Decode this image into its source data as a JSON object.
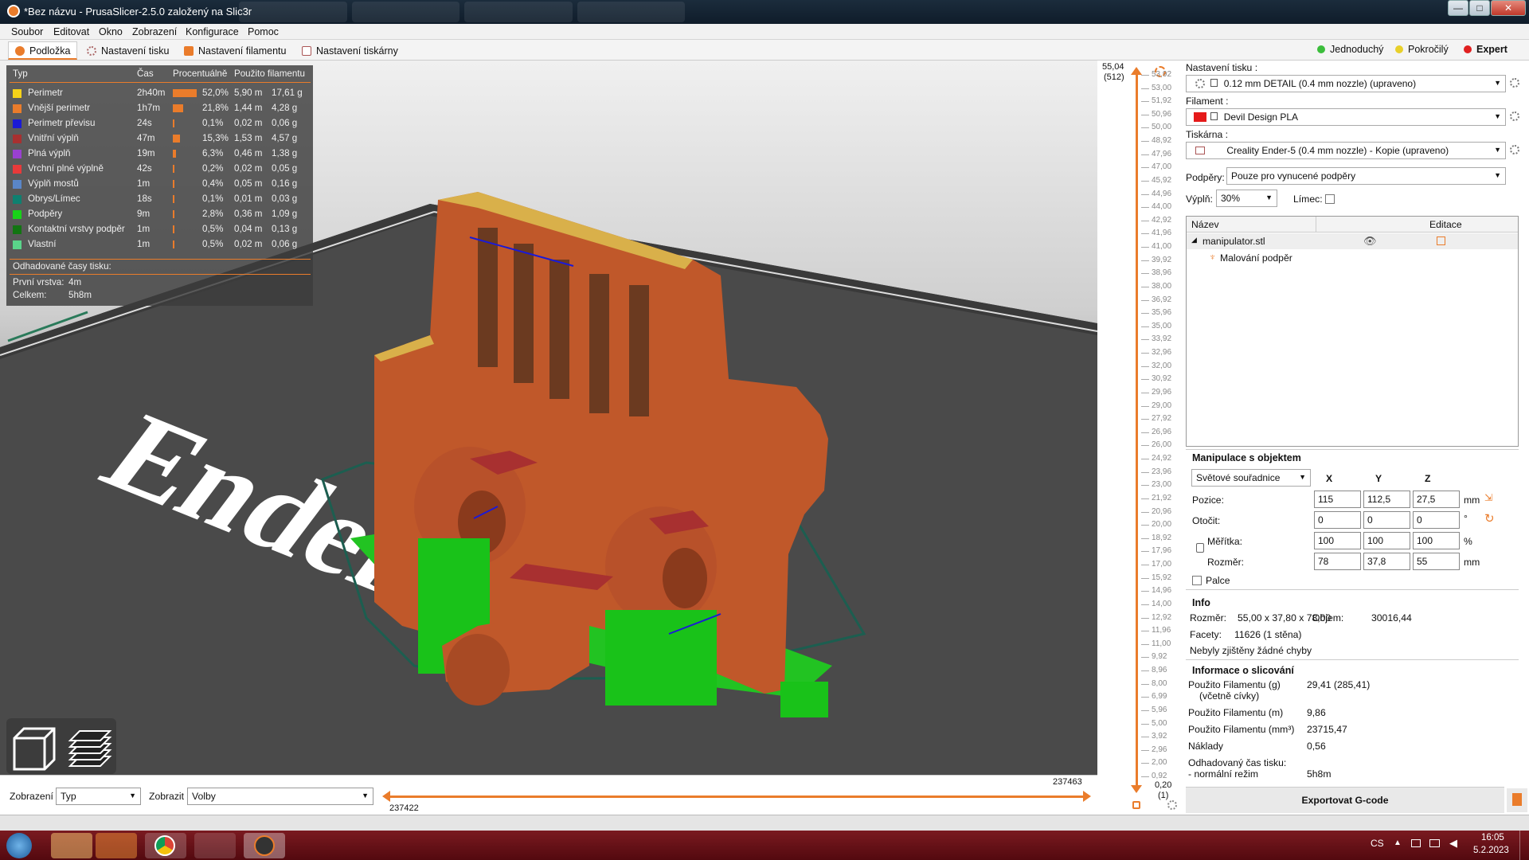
{
  "window": {
    "title": "*Bez názvu - PrusaSlicer-2.5.0 založený na Slic3r",
    "minimize": "—",
    "maximize": "□",
    "close": "✕"
  },
  "menu": [
    "Soubor",
    "Editovat",
    "Okno",
    "Zobrazení",
    "Konfigurace",
    "Pomoc"
  ],
  "tabs": [
    {
      "label": "Podložka",
      "active": true
    },
    {
      "label": "Nastavení tisku",
      "active": false
    },
    {
      "label": "Nastavení filamentu",
      "active": false
    },
    {
      "label": "Nastavení tiskárny",
      "active": false
    }
  ],
  "modes": [
    {
      "label": "Jednoduchý",
      "color": "#3bbd3b"
    },
    {
      "label": "Pokročilý",
      "color": "#e8d02a"
    },
    {
      "label": "Expert",
      "color": "#e02020"
    }
  ],
  "legend": {
    "headers": {
      "type": "Typ",
      "time": "Čas",
      "percent": "Procentuálně",
      "used": "Použito filamentu"
    },
    "rows": [
      {
        "type": "Perimetr",
        "color": "#f5d21a",
        "time": "2h40m",
        "pct": "52,0%",
        "pct_value": 52.0,
        "m": "5,90 m",
        "g": "17,61 g"
      },
      {
        "type": "Vnější perimetr",
        "color": "#ea7c2b",
        "time": "1h7m",
        "pct": "21,8%",
        "pct_value": 21.8,
        "m": "1,44 m",
        "g": "4,28 g"
      },
      {
        "type": "Perimetr převisu",
        "color": "#1a1ad6",
        "time": "24s",
        "pct": "0,1%",
        "pct_value": 0.1,
        "m": "0,02 m",
        "g": "0,06 g"
      },
      {
        "type": "Vnitřní výplň",
        "color": "#a83030",
        "time": "47m",
        "pct": "15,3%",
        "pct_value": 15.3,
        "m": "1,53 m",
        "g": "4,57 g"
      },
      {
        "type": "Plná výplň",
        "color": "#9a40d0",
        "time": "19m",
        "pct": "6,3%",
        "pct_value": 6.3,
        "m": "0,46 m",
        "g": "1,38 g"
      },
      {
        "type": "Vrchní plné výplně",
        "color": "#e83a3a",
        "time": "42s",
        "pct": "0,2%",
        "pct_value": 0.2,
        "m": "0,02 m",
        "g": "0,05 g"
      },
      {
        "type": "Výplň mostů",
        "color": "#5a86c8",
        "time": "1m",
        "pct": "0,4%",
        "pct_value": 0.4,
        "m": "0,05 m",
        "g": "0,16 g"
      },
      {
        "type": "Obrys/Límec",
        "color": "#0e8070",
        "time": "18s",
        "pct": "0,1%",
        "pct_value": 0.1,
        "m": "0,01 m",
        "g": "0,03 g"
      },
      {
        "type": "Podpěry",
        "color": "#19d219",
        "time": "9m",
        "pct": "2,8%",
        "pct_value": 2.8,
        "m": "0,36 m",
        "g": "1,09 g"
      },
      {
        "type": "Kontaktní vrstvy podpěr",
        "color": "#127512",
        "time": "1m",
        "pct": "0,5%",
        "pct_value": 0.5,
        "m": "0,04 m",
        "g": "0,13 g"
      },
      {
        "type": "Vlastní",
        "color": "#5ad48a",
        "time": "1m",
        "pct": "0,5%",
        "pct_value": 0.5,
        "m": "0,02 m",
        "g": "0,06 g"
      }
    ],
    "estimated_title": "Odhadované časy tisku:",
    "first_layer_label": "První vrstva:",
    "first_layer": "4m",
    "total_label": "Celkem:",
    "total": "5h8m"
  },
  "bottom": {
    "view_label": "Zobrazení",
    "view_value": "Typ",
    "show_label": "Zobrazit",
    "show_value": "Volby",
    "slider_low": "237422",
    "slider_high": "237463"
  },
  "vslider": {
    "top_value": "55,04",
    "top_layer": "(512)",
    "bottom_value": "0,20",
    "bottom_layer": "(1)",
    "ticks": [
      "53,92",
      "53,00",
      "51,92",
      "50,96",
      "50,00",
      "48,92",
      "47,96",
      "47,00",
      "45,92",
      "44,96",
      "44,00",
      "42,92",
      "41,96",
      "41,00",
      "39,92",
      "38,96",
      "38,00",
      "36,92",
      "35,96",
      "35,00",
      "33,92",
      "32,96",
      "32,00",
      "30,92",
      "29,96",
      "29,00",
      "27,92",
      "26,96",
      "26,00",
      "24,92",
      "23,96",
      "23,00",
      "21,92",
      "20,96",
      "20,00",
      "18,92",
      "17,96",
      "17,00",
      "15,92",
      "14,96",
      "14,00",
      "12,92",
      "11,96",
      "11,00",
      "9,92",
      "8,96",
      "8,00",
      "6,99",
      "5,96",
      "5,00",
      "3,92",
      "2,96",
      "2,00",
      "0,92"
    ]
  },
  "right": {
    "print_settings_label": "Nastavení tisku :",
    "print_settings_value": "0.12 mm DETAIL (0.4 mm nozzle) (upraveno)",
    "filament_label": "Filament :",
    "filament_value": "Devil Design PLA",
    "printer_label": "Tiskárna :",
    "printer_value": "Creality Ender-5 (0.4 mm nozzle) - Kopie (upraveno)",
    "supports_label": "Podpěry:",
    "supports_value": "Pouze pro vynucené podpěry",
    "infill_label": "Výplň:",
    "infill_value": "30%",
    "brim_label": "Límec:",
    "objects_header_name": "Název",
    "objects_header_edit": "Editace",
    "object_name": "manipulator.stl",
    "object_child": "Malování podpěr",
    "manip_title": "Manipulace s objektem",
    "coord_system": "Světové souřadnice",
    "axis_x": "X",
    "axis_y": "Y",
    "axis_z": "Z",
    "position_label": "Pozice:",
    "position": [
      "115",
      "112,5",
      "27,5"
    ],
    "position_unit": "mm",
    "rotate_label": "Otočit:",
    "rotate": [
      "0",
      "0",
      "0"
    ],
    "rotate_unit": "°",
    "scale_label": "Měřítka:",
    "scale": [
      "100",
      "100",
      "100"
    ],
    "scale_unit": "%",
    "size_label": "Rozměr:",
    "size": [
      "78",
      "37,8",
      "55"
    ],
    "size_unit": "mm",
    "inches_label": "Palce",
    "info_title": "Info",
    "info_size_label": "Rozměr:",
    "info_size": "55,00 x 37,80 x 78,00",
    "info_volume_label": "Objem:",
    "info_volume": "30016,44",
    "info_facets_label": "Facety:",
    "info_facets": "11626 (1 stěna)",
    "info_errors": "Nebyly zjištěny žádné chyby",
    "slice_title": "Informace o slicování",
    "slice_rows": [
      {
        "label": "Použito Filamentu (g)",
        "value": "29,41 (285,41)"
      },
      {
        "label": "(včetně cívky)",
        "value": ""
      },
      {
        "label": "Použito Filamentu (m)",
        "value": "9,86"
      },
      {
        "label": "Použito Filamentu (mm³)",
        "value": "23715,47"
      },
      {
        "label": "Náklady",
        "value": "0,56"
      },
      {
        "label": "Odhadovaný čas tisku:",
        "value": ""
      },
      {
        "label": " - normální režim",
        "value": "5h8m"
      }
    ],
    "export_button": "Exportovat G-code"
  },
  "taskbar": {
    "lang": "CS",
    "time": "16:05",
    "date": "5.2.2023"
  },
  "bed_text": "Ender"
}
